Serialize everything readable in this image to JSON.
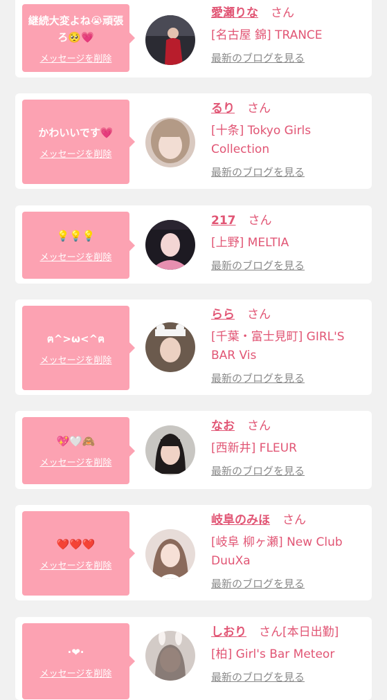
{
  "messages": [
    {
      "message": "継続大変よね😭頑張ろ🥺💗",
      "delete_label": "メッセージを削除",
      "avatar": "avatar-photo-dark-red-dress",
      "name": "愛瀬りな",
      "suffix": "さん",
      "shop": "[名古屋 錦] TRANCE",
      "blog_link": "最新のブログを見る"
    },
    {
      "message": "かわいいです💗",
      "delete_label": "メッセージを削除",
      "avatar": "avatar-photo-light-hair",
      "name": "るり",
      "suffix": "さん",
      "shop": "[十条] Tokyo Girls Collection",
      "blog_link": "最新のブログを見る"
    },
    {
      "message": "💡💡💡",
      "delete_label": "メッセージを削除",
      "avatar": "avatar-photo-dark-hair-pink",
      "name": "217",
      "suffix": "さん",
      "shop": "[上野] MELTIA",
      "blog_link": "最新のブログを見る"
    },
    {
      "message": "ฅ^>ω<^ฅ",
      "delete_label": "メッセージを削除",
      "avatar": "avatar-photo-cat-ears",
      "name": "らら",
      "suffix": "さん",
      "shop": "[千葉・富士見町] GIRL'S BAR Vis",
      "blog_link": "最新のブログを見る"
    },
    {
      "message": "💖🤍🙈",
      "delete_label": "メッセージを削除",
      "avatar": "avatar-photo-bob-hair",
      "name": "なお",
      "suffix": "さん",
      "shop": "[西新井] FLEUR",
      "blog_link": "最新のブログを見る"
    },
    {
      "message": "❤️❤️❤️",
      "delete_label": "メッセージを削除",
      "avatar": "avatar-photo-long-hair-light",
      "name": "岐阜のみほ",
      "suffix": "さん",
      "shop": "[岐阜 柳ヶ瀬] New Club DuuXa",
      "blog_link": "最新のブログを見る"
    },
    {
      "message": "·❤·",
      "delete_label": "メッセージを削除",
      "avatar": "avatar-photo-bunny-ears",
      "name": "しおり",
      "suffix": "さん[本日出勤]",
      "shop": "[柏] Girl's Bar Meteor",
      "blog_link": "最新のブログを見る"
    }
  ],
  "colors": {
    "background": "#f1f1f1",
    "card": "#ffffff",
    "bubble": "#fca2b2",
    "accent": "#e15574",
    "link_gray": "#8a8a8a"
  }
}
